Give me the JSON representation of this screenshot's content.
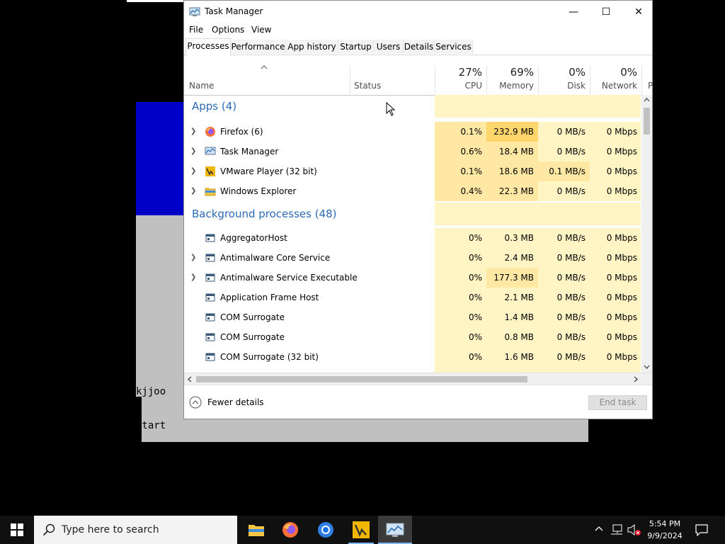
{
  "background_app": {
    "line1": "kjjoo",
    "line2": "start"
  },
  "window": {
    "title": "Task Manager",
    "minimize_glyph": "—",
    "maximize_glyph": "☐",
    "close_glyph": "✕"
  },
  "menu": [
    "File",
    "Options",
    "View"
  ],
  "tabs": [
    "Processes",
    "Performance",
    "App history",
    "Startup",
    "Users",
    "Details",
    "Services"
  ],
  "columns": {
    "name": "Name",
    "status": "Status",
    "cpu": {
      "label": "CPU",
      "pct": "27%"
    },
    "memory": {
      "label": "Memory",
      "pct": "69%"
    },
    "disk": {
      "label": "Disk",
      "pct": "0%"
    },
    "network": {
      "label": "Network",
      "pct": "0%"
    },
    "power_partial": "P"
  },
  "groups": {
    "apps": "Apps (4)",
    "background": "Background processes (48)"
  },
  "apps": [
    {
      "name": "Firefox (6)",
      "cpu": "0.1%",
      "memory": "232.9 MB",
      "disk": "0 MB/s",
      "network": "0 Mbps",
      "icon": "firefox-icon"
    },
    {
      "name": "Task Manager",
      "cpu": "0.6%",
      "memory": "18.4 MB",
      "disk": "0 MB/s",
      "network": "0 Mbps",
      "icon": "task-manager-icon"
    },
    {
      "name": "VMware Player (32 bit)",
      "cpu": "0.1%",
      "memory": "18.6 MB",
      "disk": "0.1 MB/s",
      "network": "0 Mbps",
      "icon": "vmware-icon"
    },
    {
      "name": "Windows Explorer",
      "cpu": "0.4%",
      "memory": "22.3 MB",
      "disk": "0 MB/s",
      "network": "0 Mbps",
      "icon": "folder-icon"
    }
  ],
  "background": [
    {
      "name": "AggregatorHost",
      "cpu": "0%",
      "memory": "0.3 MB",
      "disk": "0 MB/s",
      "network": "0 Mbps"
    },
    {
      "name": "Antimalware Core Service",
      "cpu": "0%",
      "memory": "2.4 MB",
      "disk": "0 MB/s",
      "network": "0 Mbps"
    },
    {
      "name": "Antimalware Service Executable",
      "cpu": "0%",
      "memory": "177.3 MB",
      "disk": "0 MB/s",
      "network": "0 Mbps"
    },
    {
      "name": "Application Frame Host",
      "cpu": "0%",
      "memory": "2.1 MB",
      "disk": "0 MB/s",
      "network": "0 Mbps"
    },
    {
      "name": "COM Surrogate",
      "cpu": "0%",
      "memory": "1.4 MB",
      "disk": "0 MB/s",
      "network": "0 Mbps"
    },
    {
      "name": "COM Surrogate",
      "cpu": "0%",
      "memory": "0.8 MB",
      "disk": "0 MB/s",
      "network": "0 Mbps"
    },
    {
      "name": "COM Surrogate (32 bit)",
      "cpu": "0%",
      "memory": "1.6 MB",
      "disk": "0 MB/s",
      "network": "0 Mbps"
    }
  ],
  "footer": {
    "fewer_details": "Fewer details",
    "end_task": "End task"
  },
  "taskbar": {
    "search_placeholder": "Type here to search",
    "time": "5:54 PM",
    "date": "9/9/2024"
  },
  "colors": {
    "heat_light": "#fff4c4",
    "heat_medium": "#ffe8a3",
    "heat_strong": "#ffd66b",
    "group_title": "#2a6ab7",
    "taskbar": "#101010"
  }
}
